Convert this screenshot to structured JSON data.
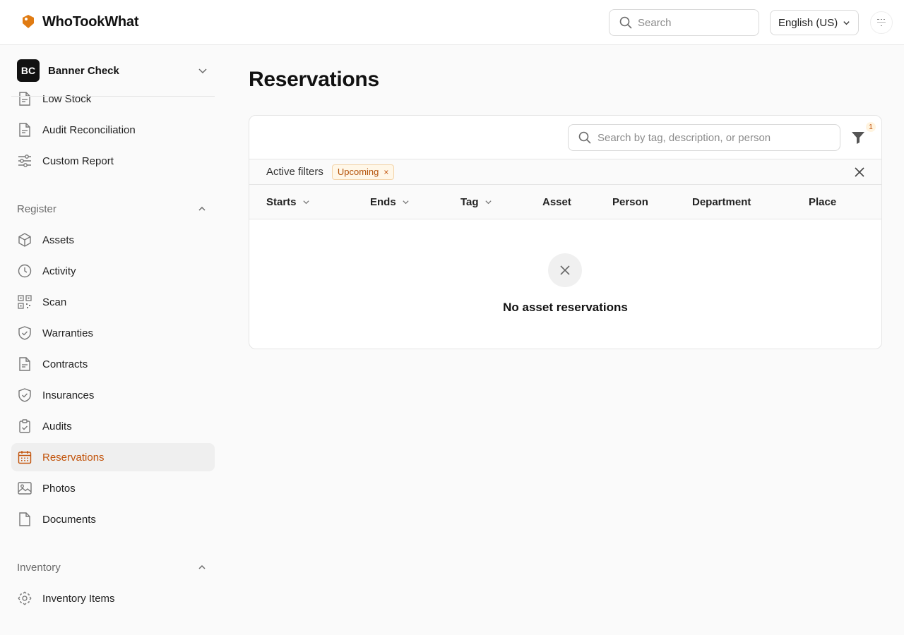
{
  "app": {
    "name": "WhoTookWhat"
  },
  "header": {
    "search_placeholder": "Search",
    "language": "English (US)"
  },
  "sidebar": {
    "org_initials": "BC",
    "org_name": "Banner Check",
    "reports_items": [
      {
        "label": "Low Stock",
        "icon": "document-icon"
      },
      {
        "label": "Audit Reconciliation",
        "icon": "document-icon"
      },
      {
        "label": "Custom Report",
        "icon": "sliders-icon"
      }
    ],
    "register": {
      "title": "Register",
      "items": [
        {
          "label": "Assets",
          "icon": "cube-icon"
        },
        {
          "label": "Activity",
          "icon": "clock-icon"
        },
        {
          "label": "Scan",
          "icon": "qr-code-icon"
        },
        {
          "label": "Warranties",
          "icon": "shield-check-icon"
        },
        {
          "label": "Contracts",
          "icon": "document-icon"
        },
        {
          "label": "Insurances",
          "icon": "shield-check-icon"
        },
        {
          "label": "Audits",
          "icon": "clipboard-check-icon"
        },
        {
          "label": "Reservations",
          "icon": "calendar-icon",
          "active": true
        },
        {
          "label": "Photos",
          "icon": "image-icon"
        },
        {
          "label": "Documents",
          "icon": "file-icon"
        }
      ]
    },
    "inventory": {
      "title": "Inventory",
      "items": [
        {
          "label": "Inventory Items",
          "icon": "scan-frame-icon"
        }
      ]
    }
  },
  "main": {
    "title": "Reservations",
    "search_placeholder": "Search by tag, description, or person",
    "filter_count": "1",
    "active_filters_label": "Active filters",
    "active_filter_chip": "Upcoming",
    "columns": [
      {
        "label": "Starts",
        "sortable": true
      },
      {
        "label": "Ends",
        "sortable": true
      },
      {
        "label": "Tag",
        "sortable": true
      },
      {
        "label": "Asset",
        "sortable": false
      },
      {
        "label": "Person",
        "sortable": false
      },
      {
        "label": "Department",
        "sortable": false
      },
      {
        "label": "Place",
        "sortable": false
      }
    ],
    "empty_message": "No asset reservations"
  },
  "colors": {
    "accent": "#c2530a",
    "brand_logo": "#e07b12",
    "active_bg": "#efefef"
  }
}
